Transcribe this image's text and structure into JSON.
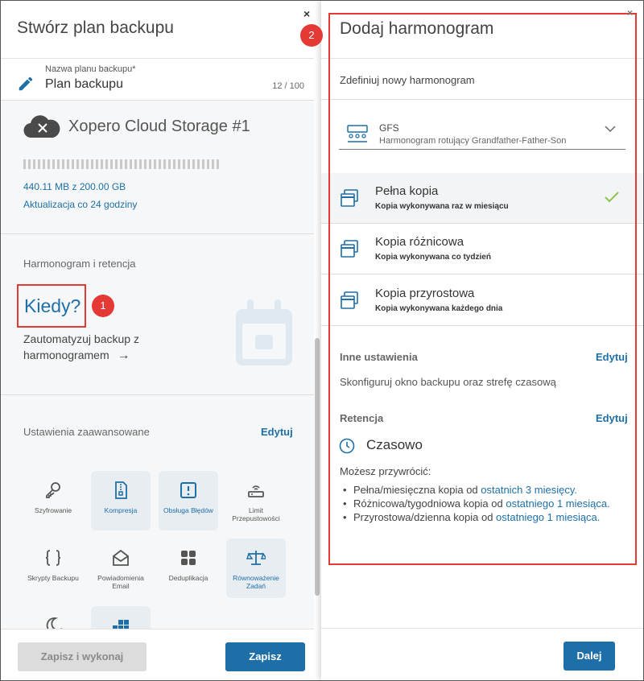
{
  "left": {
    "title": "Stwórz plan backupu",
    "close": "×",
    "plan_name_label": "Nazwa planu backupu*",
    "plan_name_value": "Plan backupu",
    "plan_name_count": "12 / 100",
    "storage_name": "Xopero Cloud Storage #1",
    "storage_usage": "440.11 MB z 200.00 GB",
    "storage_update": "Aktualizacja co 24 godziny",
    "schedule_section_title": "Harmonogram i retencja",
    "schedule_heading": "Kiedy?",
    "schedule_desc_line1": "Zautomatyzuj backup z",
    "schedule_desc_line2": "harmonogramem",
    "schedule_arrow": "→",
    "advanced_title": "Ustawienia zaawansowane",
    "advanced_edit": "Edytuj",
    "tiles": [
      {
        "label": "Szyfrowanie",
        "icon": "key-icon"
      },
      {
        "label": "Kompresja",
        "icon": "compression-icon"
      },
      {
        "label": "Obsługa Błędów",
        "icon": "error-handling-icon"
      },
      {
        "label": "Limit Przepustowości",
        "icon": "bandwidth-router-icon"
      },
      {
        "label": "Skrypty Backupu",
        "icon": "script-braces-icon"
      },
      {
        "label": "Powiadomienia Email",
        "icon": "email-icon"
      },
      {
        "label": "Deduplikacja",
        "icon": "deduplication-icon"
      },
      {
        "label": "Równoważenie Zadań",
        "icon": "balance-scale-icon"
      },
      {
        "label": "",
        "icon": "moon-icon"
      },
      {
        "label": "",
        "icon": "blocks-icon"
      }
    ],
    "btn_run": "Zapisz i wykonaj",
    "btn_save": "Zapisz"
  },
  "right": {
    "title": "Dodaj harmonogram",
    "close": "×",
    "define_label": "Zdefiniuj nowy harmonogram",
    "gfs_title": "GFS",
    "gfs_sub": "Harmonogram rotujący Grandfather-Father-Son",
    "copies": [
      {
        "title": "Pełna kopia",
        "sub": "Kopia wykonywana raz w miesiącu"
      },
      {
        "title": "Kopia różnicowa",
        "sub": "Kopia wykonywana co tydzień"
      },
      {
        "title": "Kopia przyrostowa",
        "sub": "Kopia wykonywana każdego dnia"
      }
    ],
    "other_title": "Inne ustawienia",
    "other_edit": "Edytuj",
    "other_desc": "Skonfiguruj okno backupu oraz strefę czasową",
    "retention_title": "Retencja",
    "retention_edit": "Edytuj",
    "retention_mode": "Czasowo",
    "restore_title": "Możesz przywrócić:",
    "restore_items": [
      {
        "text": "Pełna/miesięczna kopia od ",
        "link": "ostatnich 3 miesięcy."
      },
      {
        "text": "Różnicowa/tygodniowa kopia od ",
        "link": "ostatniego 1 miesiąca."
      },
      {
        "text": "Przyrostowa/dzienna kopia od ",
        "link": "ostatniego 1 miesiąca."
      }
    ],
    "btn_next": "Dalej"
  },
  "annotations": {
    "badge1": "1",
    "badge2": "2"
  },
  "colors": {
    "accent": "#1e6fa8",
    "annotation": "#e53935",
    "check": "#8bc34a"
  }
}
